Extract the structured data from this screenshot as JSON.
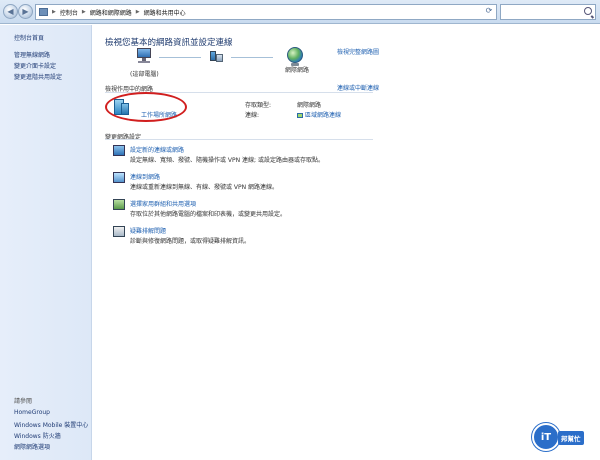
{
  "breadcrumb": [
    "控制台",
    "網路和網際網路",
    "網路和共用中心"
  ],
  "search": {
    "placeholder": ""
  },
  "sidebar": {
    "top_links": [
      "控制台首頁",
      "管理無線網路",
      "變更介面卡設定",
      "變更進階共用設定"
    ],
    "see_also_heading": "請參閱",
    "bottom_links": [
      "HomeGroup",
      "Windows Mobile 裝置中心",
      "Windows 防火牆",
      "網際網路選項"
    ]
  },
  "main": {
    "title": "檢視您基本的網路資訊並設定連線",
    "full_map_link": "檢視完整網路圖",
    "map": {
      "pc_label": "(這部電腦)",
      "internet_label": "網際網路"
    },
    "active": {
      "heading": "檢視作用中的網路",
      "connect_link": "連線或中斷連線",
      "network_name": "工作場所網路",
      "access_type_label": "存取類型:",
      "access_type_value": "網際網路",
      "connections_label": "連線:",
      "connections_value": "區域網路連線"
    },
    "change_heading": "變更網路設定",
    "tasks": [
      {
        "title": "設定新的連線或網路",
        "desc": "設定無線、寬頻、撥號、隨機操作或 VPN 連線; 或設定路由器或存取點。"
      },
      {
        "title": "連線到網路",
        "desc": "連線或重新連線到無線、有線、撥號或 VPN 網路連線。"
      },
      {
        "title": "選擇家用群組和共用選項",
        "desc": "存取位於其他網路電腦的檔案和印表機，或變更共用設定。"
      },
      {
        "title": "疑難排解問題",
        "desc": "診斷與修復網路問題，或取得疑難排解資訊。"
      }
    ]
  },
  "watermark": {
    "logo": "iT",
    "text": "邦幫忙"
  },
  "colors": {
    "link": "#1d5fb0",
    "sidebar_bg": "#dde8f7",
    "highlight_ellipse": "#d11f1f"
  }
}
